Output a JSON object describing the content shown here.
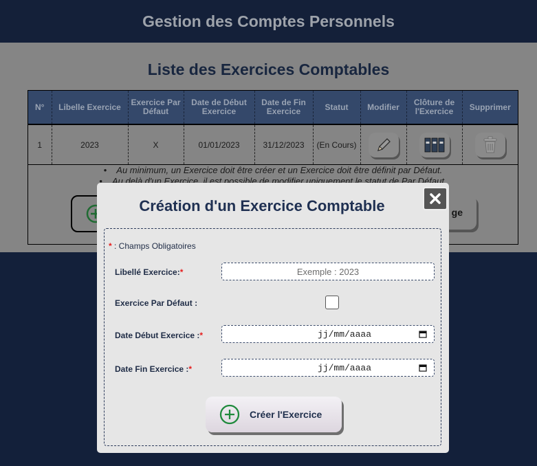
{
  "header": {
    "title": "Gestion des Comptes Personnels"
  },
  "page": {
    "title": "Liste des Exercices Comptables"
  },
  "table": {
    "columns": [
      "N°",
      "Libelle Exercice",
      "Exercice Par Défaut",
      "Date de Début Exercice",
      "Date de Fin Exercice",
      "Statut",
      "Modifier",
      "Clôture de l'Exercice",
      "Supprimer"
    ],
    "rows": [
      {
        "num": "1",
        "libelle": "2023",
        "defaut": "X",
        "debut": "01/01/2023",
        "fin": "31/12/2023",
        "statut": "(En Cours)"
      }
    ]
  },
  "notes": [
    "Au minimum, un Exercice doit être créer et un Exercice doit être définit par Défaut.",
    "Au delà d'un Exercice, il est possible de modifier uniquement le statut de Par Défaut."
  ],
  "background_buttons": {
    "right_label_fragment": "ge"
  },
  "modal": {
    "title": "Création d'un Exercice Comptable",
    "required_marker": "*",
    "required_note": ": Champs Obligatoires",
    "fields": {
      "libelle": {
        "label": "Libellé Exercice:",
        "placeholder": "Exemple : 2023"
      },
      "defaut": {
        "label": "Exercice Par Défaut :",
        "checked": false
      },
      "debut": {
        "label": "Date Début Exercice :",
        "value": "jj/mm/aaaa"
      },
      "fin": {
        "label": "Date Fin Exercice :",
        "value": "jj/mm/aaaa"
      }
    },
    "submit_label": "Créer l'Exercice"
  },
  "colors": {
    "header": "#142039",
    "accent_green": "#1f8a3c",
    "required_red": "#e51d1d",
    "title_navy": "#1f3052"
  }
}
